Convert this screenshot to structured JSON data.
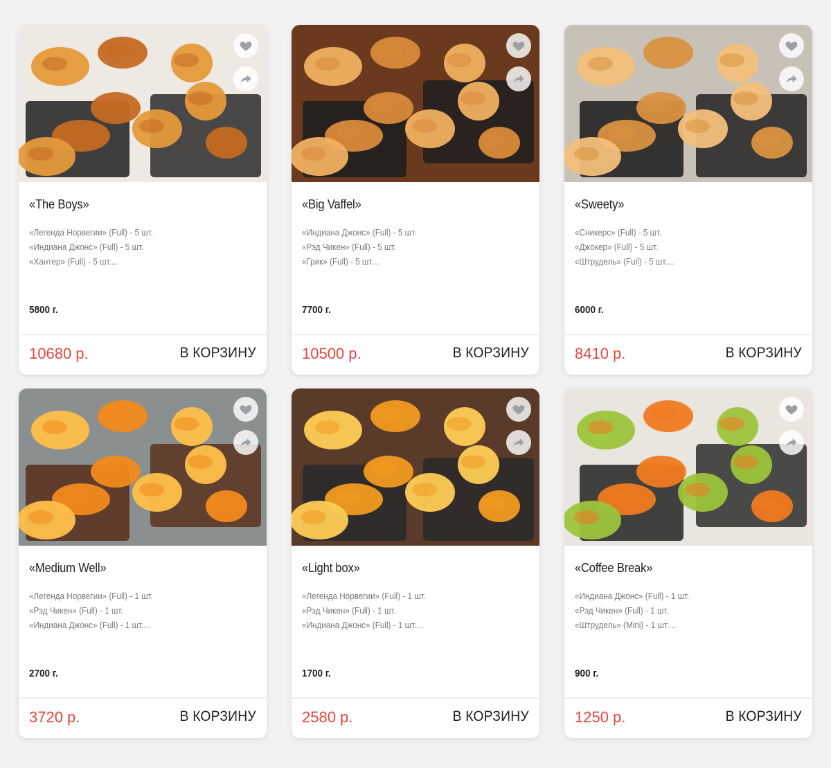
{
  "cards": [
    {
      "title": "«The Boys»",
      "items": [
        "«Легенда Норвегии» (Full) - 5 шт.",
        "«Индиана Джонс» (Full) - 5 шт.",
        "«Хантер» (Full) - 5 шт...."
      ],
      "weight": "5800 г.",
      "price": "10680 р.",
      "cart_label": "В КОРЗИНУ",
      "photo": {
        "bg": "#efe9e3",
        "accent": "#c46a22",
        "dark": "#2b2b2b",
        "highlight": "#e59a3a"
      }
    },
    {
      "title": "«Big Vaffel»",
      "items": [
        "«Индиана Джонс» (Full) - 5 шт.",
        "«Рэд Чикен» (Full) - 5 шт.",
        "«Грик» (Full) - 5 шт...."
      ],
      "weight": "7700 г.",
      "price": "10500 р.",
      "cart_label": "В КОРЗИНУ",
      "photo": {
        "bg": "#6b3a1e",
        "accent": "#d98a3a",
        "dark": "#1f1f1f",
        "highlight": "#f0b060"
      }
    },
    {
      "title": "«Sweety»",
      "items": [
        "«Сникерс» (Full) - 5 шт.",
        "«Джокер» (Full) - 5 шт.",
        "«Штрудель» (Full) - 5 шт...."
      ],
      "weight": "6000 г.",
      "price": "8410 р.",
      "cart_label": "В КОРЗИНУ",
      "photo": {
        "bg": "#c7c1b8",
        "accent": "#d99240",
        "dark": "#222222",
        "highlight": "#f3c07a"
      }
    },
    {
      "title": "«Medium Well»",
      "items": [
        "«Легенда Норвегии» (Full) - 1 шт.",
        "«Рэд Чикен» (Full) - 1 шт.",
        "«Индиана Джонс» (Full) - 1 шт...."
      ],
      "weight": "2700 г.",
      "price": "3720 р.",
      "cart_label": "В КОРЗИНУ",
      "photo": {
        "bg": "#8a8f90",
        "accent": "#f28a1c",
        "dark": "#5a3320",
        "highlight": "#ffc04a"
      }
    },
    {
      "title": "«Light box»",
      "items": [
        "«Легенда Норвегии» (Full) - 1 шт.",
        "«Рэд Чикен» (Full) - 1 шт.",
        "«Индиана Джонс» (Full) - 1 шт...."
      ],
      "weight": "1700 г.",
      "price": "2580 р.",
      "cart_label": "В КОРЗИНУ",
      "photo": {
        "bg": "#5a3a28",
        "accent": "#f29a20",
        "dark": "#2a2a2a",
        "highlight": "#ffcc55"
      }
    },
    {
      "title": "«Coffee Break»",
      "items": [
        "«Индиана Джонс» (Full) - 1 шт.",
        "«Рэд Чикен» (Full) - 1 шт.",
        "«Штрудель» (Mini) - 1 шт...."
      ],
      "weight": "900 г.",
      "price": "1250 р.",
      "cart_label": "В КОРЗИНУ",
      "photo": {
        "bg": "#e9e6df",
        "accent": "#f07a20",
        "dark": "#2d2d2d",
        "highlight": "#9cc43a"
      }
    }
  ],
  "icons": {
    "favorite": "heart-icon",
    "share": "share-icon"
  },
  "colors": {
    "price": "#e8453c",
    "card_bg": "#ffffff",
    "page_bg": "#f2f2f2"
  }
}
